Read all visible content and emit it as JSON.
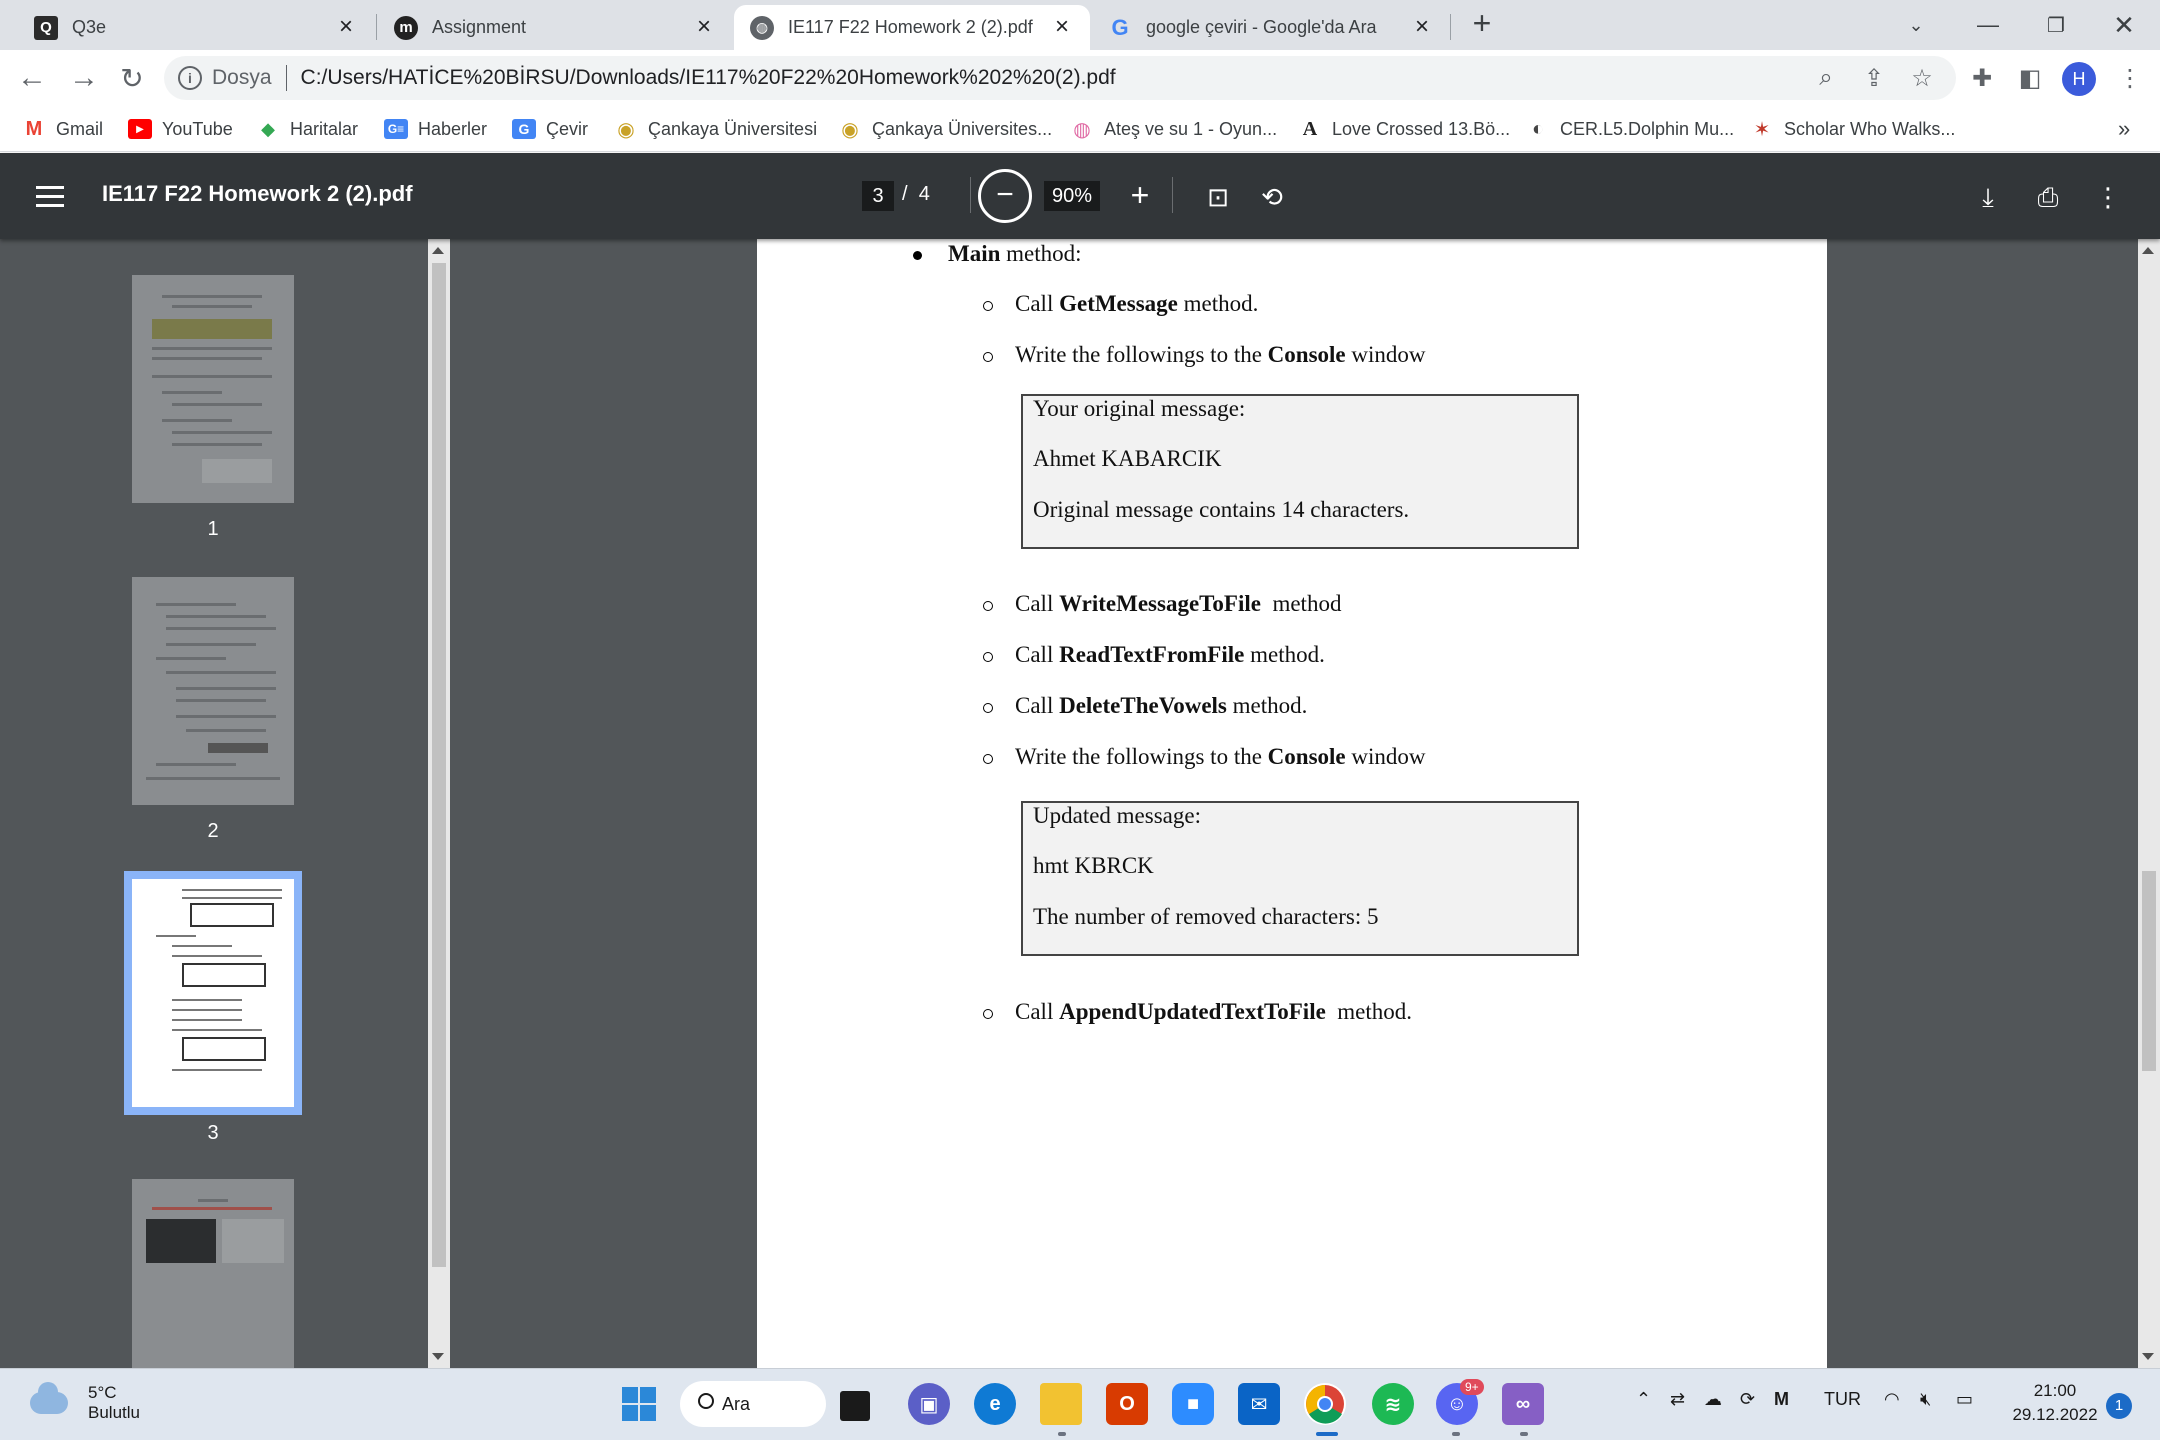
{
  "tabs": [
    {
      "title": "Q3e",
      "icon": "q-icon",
      "active": false
    },
    {
      "title": "Assignment",
      "icon": "m-icon",
      "active": false
    },
    {
      "title": "IE117 F22 Homework 2 (2).pdf",
      "icon": "globe-icon",
      "active": true
    },
    {
      "title": "google çeviri - Google'da Ara",
      "icon": "google-icon",
      "active": false
    }
  ],
  "address": {
    "scheme_label": "Dosya",
    "url": "C:/Users/HATİCE%20BİRSU/Downloads/IE117%20F22%20Homework%202%20(2).pdf"
  },
  "profile_initial": "H",
  "bookmarks": [
    {
      "label": "Gmail",
      "icon": "M",
      "color": "#ea4335"
    },
    {
      "label": "YouTube",
      "icon": "▶",
      "color": "#ff0000"
    },
    {
      "label": "Haritalar",
      "icon": "◆",
      "color": "#34a853"
    },
    {
      "label": "Haberler",
      "icon": "G",
      "color": "#4285f4"
    },
    {
      "label": "Çevir",
      "icon": "G",
      "color": "#4285f4"
    },
    {
      "label": "Çankaya Üniversitesi",
      "icon": "◉",
      "color": "#c9a227"
    },
    {
      "label": "Çankaya Üniversites...",
      "icon": "◉",
      "color": "#c9a227"
    },
    {
      "label": "Ateş ve su 1 - Oyun...",
      "icon": "◍",
      "color": "#e06aa4"
    },
    {
      "label": "Love Crossed 13.Bö...",
      "icon": "A",
      "color": "#222222"
    },
    {
      "label": "CER.L5.Dolphin Mu...",
      "icon": "◐",
      "color": "#444444"
    },
    {
      "label": "Scholar Who Walks...",
      "icon": "✶",
      "color": "#c0392b"
    }
  ],
  "bookmarks_more": "»",
  "pdf": {
    "title": "IE117 F22 Homework 2 (2).pdf",
    "current_page": "3",
    "page_sep": "/",
    "total_pages": "4",
    "zoom": "90%",
    "thumb_labels": [
      "1",
      "2",
      "3"
    ]
  },
  "content": {
    "main_bullet": {
      "bold": "Main",
      "rest": " method:"
    },
    "items_top": [
      {
        "pre": "Call ",
        "bold": "GetMessage",
        "post": " method."
      },
      {
        "pre": "Write the followings to the ",
        "bold": "Console",
        "post": " window"
      }
    ],
    "box1": [
      "Your original message:",
      "Ahmet KABARCIK",
      "Original message contains 14 characters."
    ],
    "items_mid": [
      {
        "pre": "Call ",
        "bold": "WriteMessageToFile",
        "post": "  method"
      },
      {
        "pre": "Call ",
        "bold": "ReadTextFromFile",
        "post": " method."
      },
      {
        "pre": "Call ",
        "bold": "DeleteTheVowels",
        "post": " method."
      },
      {
        "pre": "Write the followings to the ",
        "bold": "Console",
        "post": " window"
      }
    ],
    "box2": [
      "Updated message:",
      "hmt KBRCK",
      "The number of removed characters: 5"
    ],
    "items_bottom": [
      {
        "pre": "Call ",
        "bold": "AppendUpdatedTextToFile",
        "post": "  method."
      }
    ]
  },
  "taskbar": {
    "weather_temp": "5°C",
    "weather_desc": "Bulutlu",
    "search_label": "Ara",
    "discord_badge": "9+",
    "lang": "TUR",
    "time": "21:00",
    "date": "29.12.2022",
    "notif_count": "1"
  }
}
